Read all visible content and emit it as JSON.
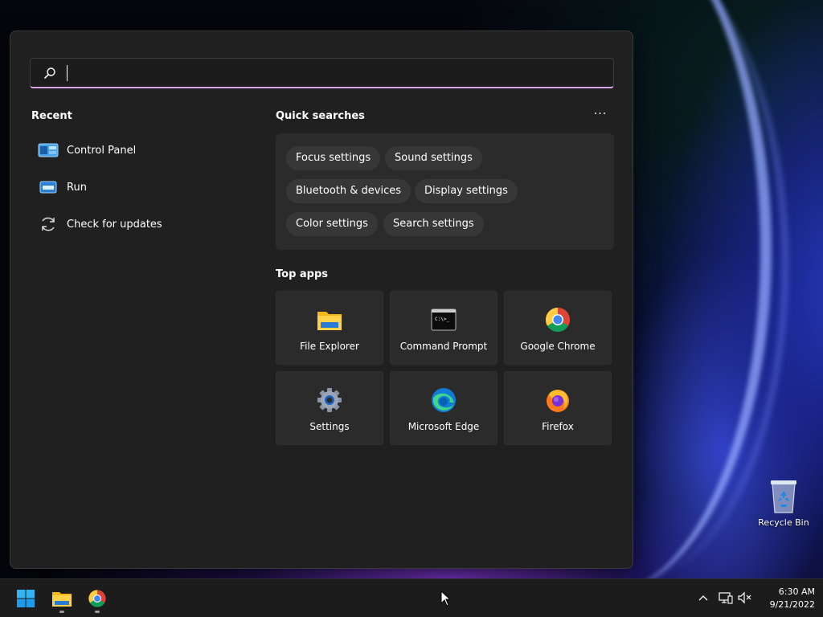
{
  "search": {
    "placeholder": "",
    "value": ""
  },
  "recent": {
    "title": "Recent",
    "items": [
      {
        "label": "Control Panel",
        "icon": "control-panel-icon"
      },
      {
        "label": "Run",
        "icon": "run-icon"
      },
      {
        "label": "Check for updates",
        "icon": "refresh-icon"
      }
    ]
  },
  "quick_searches": {
    "title": "Quick searches",
    "more_label": "···",
    "chips": [
      "Focus settings",
      "Sound settings",
      "Bluetooth & devices",
      "Display settings",
      "Color settings",
      "Search settings"
    ]
  },
  "top_apps": {
    "title": "Top apps",
    "apps": [
      {
        "label": "File Explorer",
        "icon": "folder-icon"
      },
      {
        "label": "Command Prompt",
        "icon": "terminal-icon"
      },
      {
        "label": "Google Chrome",
        "icon": "chrome-icon"
      },
      {
        "label": "Settings",
        "icon": "gear-icon"
      },
      {
        "label": "Microsoft Edge",
        "icon": "edge-icon"
      },
      {
        "label": "Firefox",
        "icon": "firefox-icon"
      }
    ]
  },
  "desktop": {
    "recycle_bin_label": "Recycle Bin"
  },
  "taskbar": {
    "time": "6:30 AM",
    "date": "9/21/2022"
  },
  "colors": {
    "panel": "#202020",
    "chip": "#373737",
    "tile": "#2b2b2b",
    "search_accent": "#d6a6e6",
    "taskbar": "#1c1c1c"
  }
}
